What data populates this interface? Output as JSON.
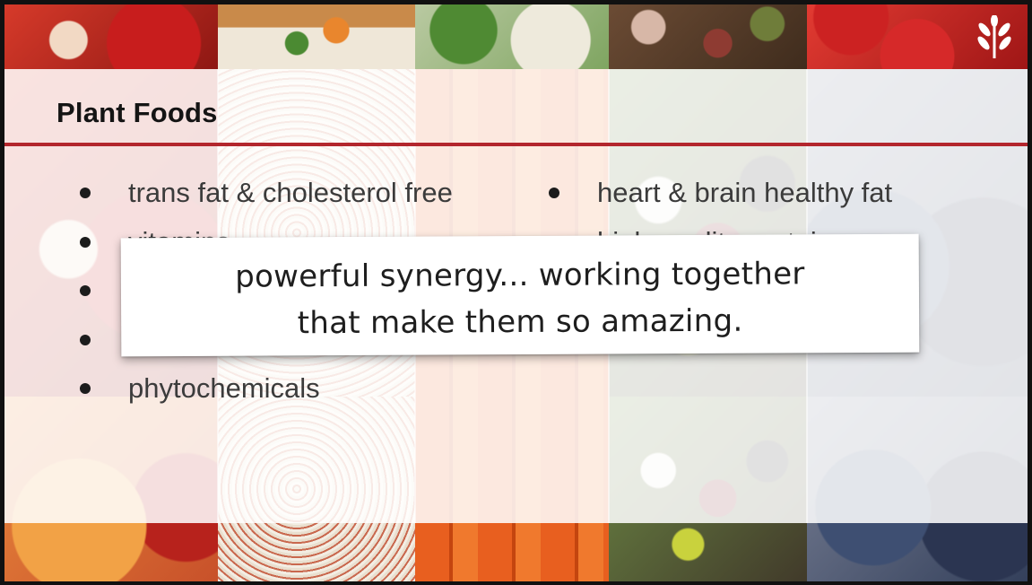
{
  "slide": {
    "title": "Plant Foods",
    "bullets_left": [
      "trans fat & cholesterol free",
      "vitamins",
      "",
      "",
      "phytochemicals"
    ],
    "bullets_right": [
      "heart & brain healthy fat",
      "high-quality protein"
    ],
    "caption_lines": [
      "powerful synergy... working together",
      "that make them so amazing."
    ]
  },
  "colors": {
    "accent_rule": "#b3262d",
    "title_text": "#141414",
    "bullet_text": "#3b3b3b"
  },
  "icons": {
    "logo": "wheat-sprout-icon",
    "bullet": "bullet-dot"
  }
}
